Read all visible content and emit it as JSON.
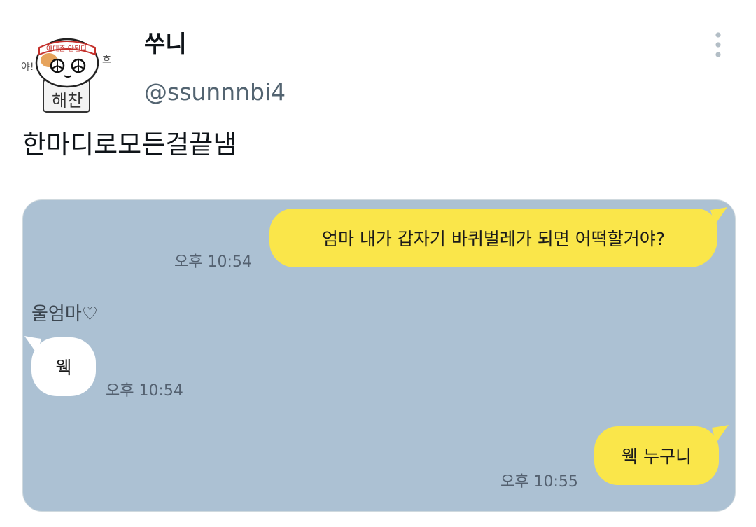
{
  "tweet": {
    "display_name": "쑤니",
    "handle": "@ssunnnbi4",
    "text": "한마디로모든걸끝냄"
  },
  "avatar": {
    "headband_text": "야대존 안된다",
    "sign_text": "해찬",
    "side_left_text": "야!",
    "side_right_text": "흐"
  },
  "chat": {
    "messages": [
      {
        "side": "right",
        "text": "엄마 내가 갑자기 바퀴벌레가 되면 어떡할거야?",
        "time": "오후 10:54"
      },
      {
        "side": "left",
        "sender": "울엄마♡",
        "text": "웩",
        "time": "오후 10:54"
      },
      {
        "side": "right",
        "text": "웩 누구니",
        "time": "오후 10:55"
      }
    ],
    "colors": {
      "background": "#acc1d3",
      "my_bubble": "#fae64a",
      "other_bubble": "#ffffff"
    }
  },
  "icons": {
    "more": "more-vertical-icon"
  }
}
